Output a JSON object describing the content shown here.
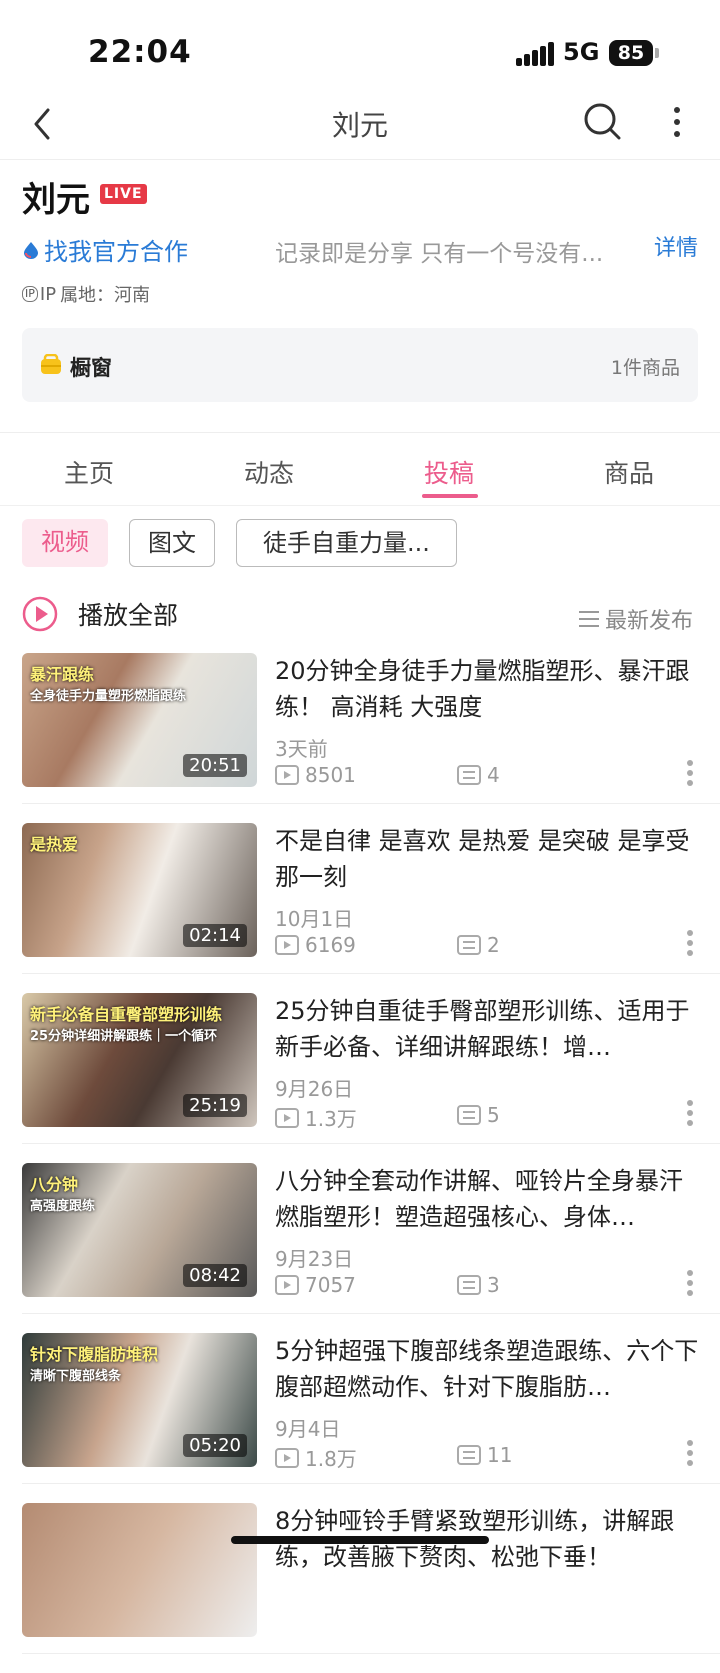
{
  "status": {
    "time": "22:04",
    "network": "5G",
    "battery": "85"
  },
  "nav": {
    "title": "刘元"
  },
  "profile": {
    "name": "刘元",
    "live_badge": "LIVE",
    "cooperate": "找我官方合作",
    "bio": "记录即是分享 只有一个号没有...",
    "detail": "详情",
    "ip_label": "IP",
    "ip": "属地：河南"
  },
  "window": {
    "label": "橱窗",
    "count": "1件商品"
  },
  "tabs": [
    "主页",
    "动态",
    "投稿",
    "商品"
  ],
  "chips": [
    "视频",
    "图文",
    "徒手自重力量..."
  ],
  "play_all": "播放全部",
  "sort": "最新发布",
  "videos": [
    {
      "title": "20分钟全身徒手力量燃脂塑形、暴汗跟练！ 高消耗 大强度",
      "date": "3天前",
      "views": "8501",
      "comments": "4",
      "duration": "20:51",
      "caption1": "暴汗跟练",
      "caption2": "全身徒手力量塑形燃脂跟练"
    },
    {
      "title": "不是自律 是喜欢 是热爱 是突破 是享受那一刻",
      "date": "10月1日",
      "views": "6169",
      "comments": "2",
      "duration": "02:14",
      "caption1": "是热爱",
      "caption2": ""
    },
    {
      "title": "25分钟自重徒手臀部塑形训练、适用于新手必备、详细讲解跟练！增…",
      "date": "9月26日",
      "views": "1.3万",
      "comments": "5",
      "duration": "25:19",
      "caption1": "新手必备自重臀部塑形训练",
      "caption2": "25分钟详细讲解跟练｜一个循环"
    },
    {
      "title": "八分钟全套动作讲解、哑铃片全身暴汗燃脂塑形！塑造超强核心、身体…",
      "date": "9月23日",
      "views": "7057",
      "comments": "3",
      "duration": "08:42",
      "caption1": "八分钟",
      "caption2": "高强度跟练"
    },
    {
      "title": "5分钟超强下腹部线条塑造跟练、六个下腹部超燃动作、针对下腹脂肪…",
      "date": "9月4日",
      "views": "1.8万",
      "comments": "11",
      "duration": "05:20",
      "caption1": "针对下腹脂肪堆积",
      "caption2": "清晰下腹部线条"
    },
    {
      "title": "8分钟哑铃手臂紧致塑形训练，讲解跟练，改善腋下赘肉、松弛下垂！",
      "date": "",
      "views": "",
      "comments": "",
      "duration": "",
      "caption1": "",
      "caption2": ""
    }
  ],
  "colors": {
    "accent": "#ec5c8c",
    "link": "#2a7bd6",
    "live": "#e63946"
  }
}
